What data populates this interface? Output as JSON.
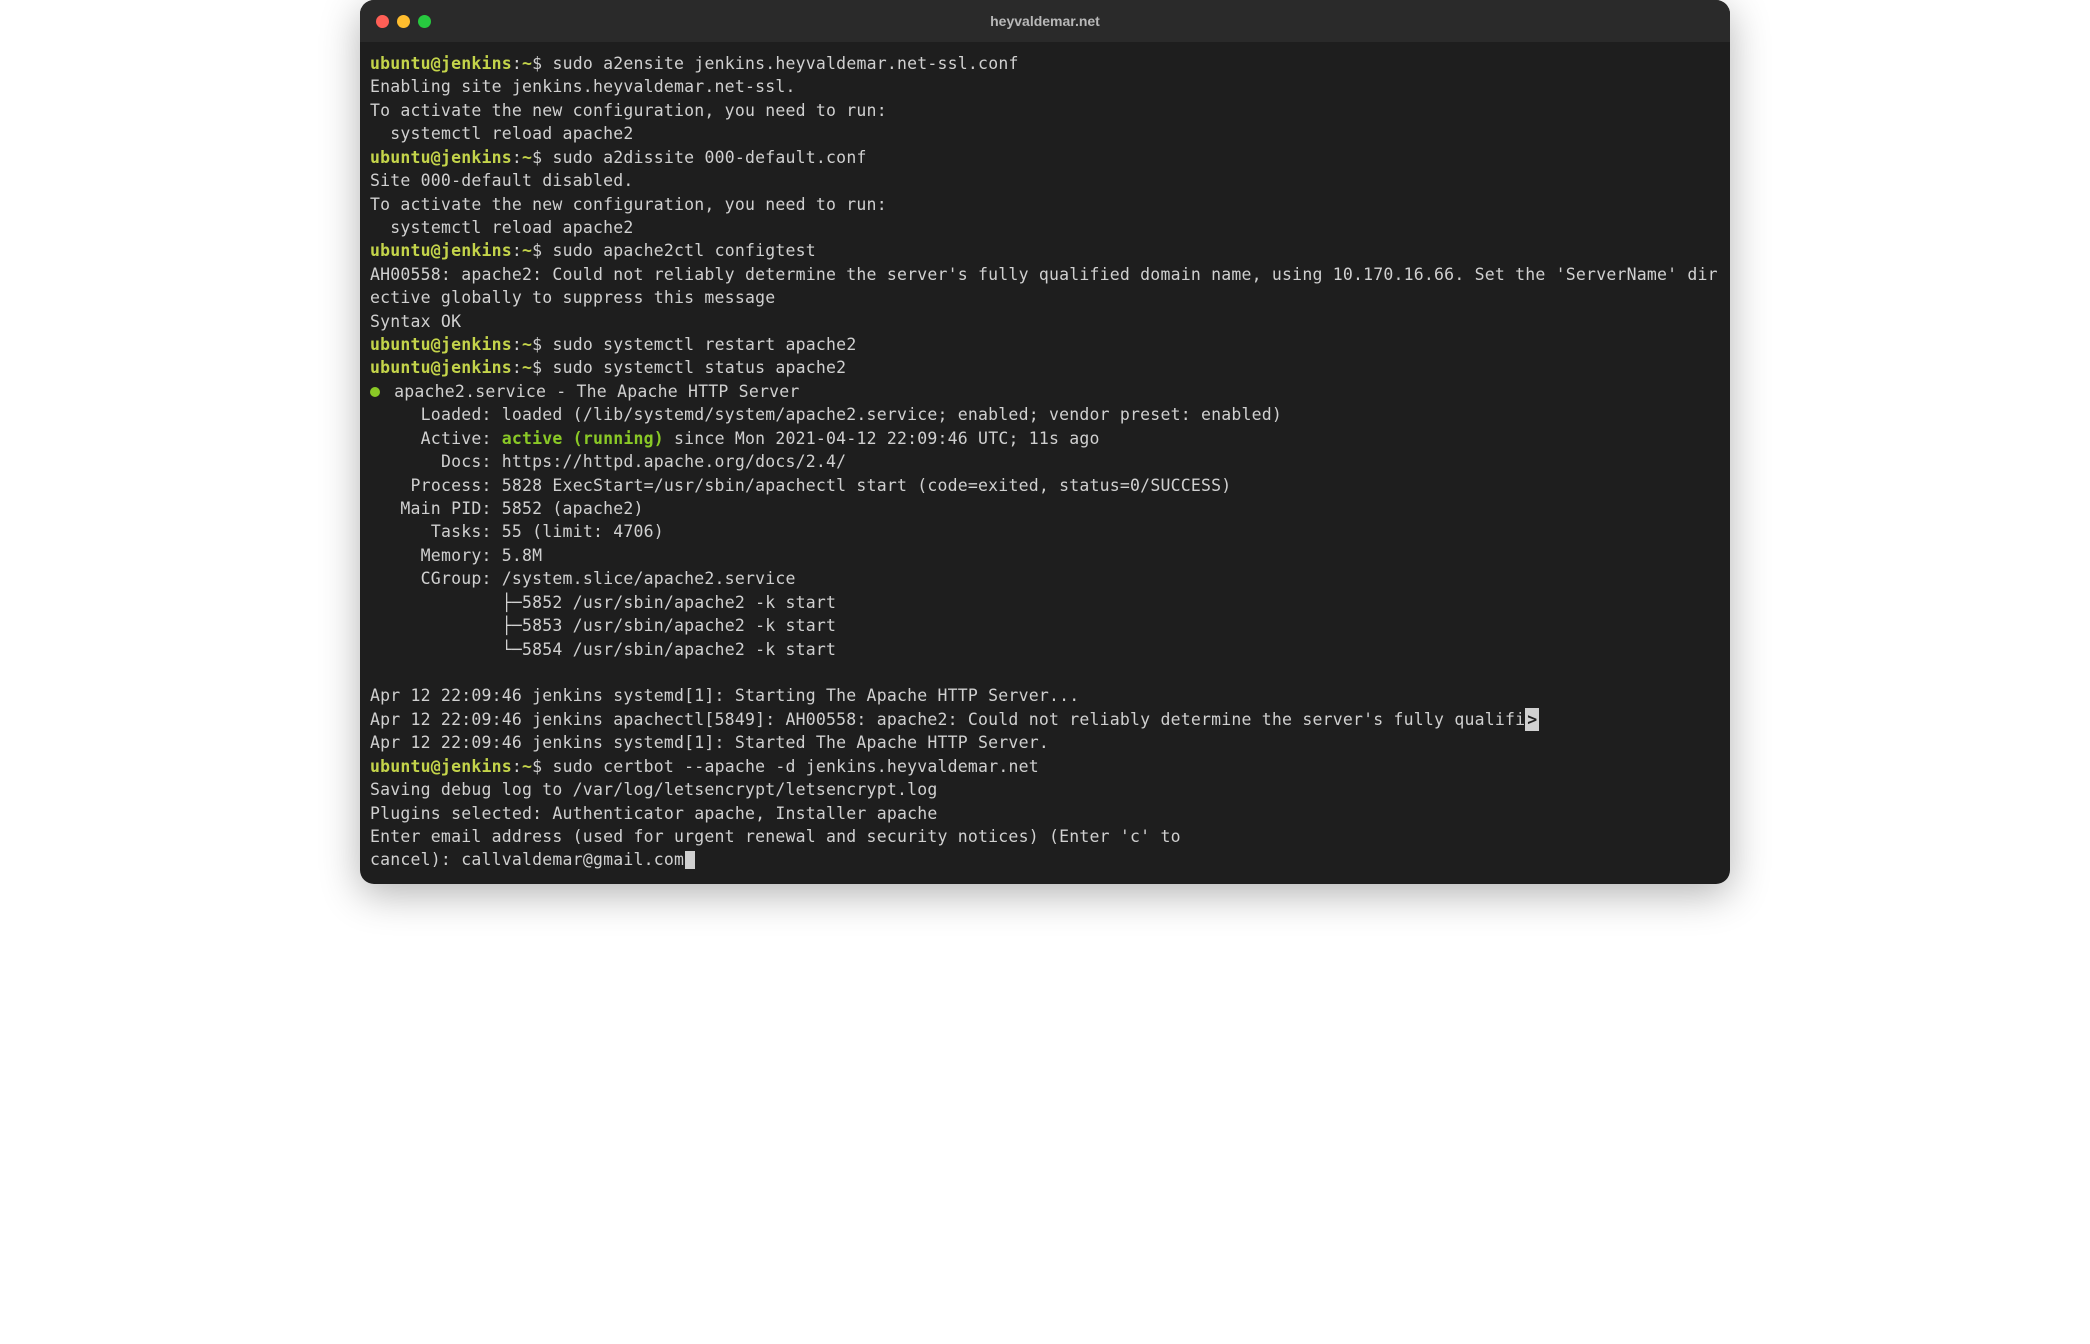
{
  "window": {
    "title": "heyvaldemar.net"
  },
  "prompt": {
    "user_host": "ubuntu@jenkins",
    "colon": ":",
    "path": "~",
    "symbol": "$"
  },
  "commands": {
    "c1": "sudo a2ensite jenkins.heyvaldemar.net-ssl.conf",
    "c2": "sudo a2dissite 000-default.conf",
    "c3": "sudo apache2ctl configtest",
    "c4": "sudo systemctl restart apache2",
    "c5": "sudo systemctl status apache2",
    "c6": "sudo certbot --apache -d jenkins.heyvaldemar.net"
  },
  "output": {
    "o1a": "Enabling site jenkins.heyvaldemar.net-ssl.",
    "o1b": "To activate the new configuration, you need to run:",
    "o1c": "  systemctl reload apache2",
    "o2a": "Site 000-default disabled.",
    "o2b": "To activate the new configuration, you need to run:",
    "o2c": "  systemctl reload apache2",
    "o3a": "AH00558: apache2: Could not reliably determine the server's fully qualified domain name, using 10.170.16.66. Set the 'ServerName' directive globally to suppress this message",
    "o3b": "Syntax OK"
  },
  "status": {
    "header": " apache2.service - The Apache HTTP Server",
    "loaded": "     Loaded: loaded (/lib/systemd/system/apache2.service; enabled; vendor preset: enabled)",
    "active_label": "     Active: ",
    "active_value": "active (running)",
    "active_since": " since Mon 2021-04-12 22:09:46 UTC; 11s ago",
    "docs": "       Docs: https://httpd.apache.org/docs/2.4/",
    "process": "    Process: 5828 ExecStart=/usr/sbin/apachectl start (code=exited, status=0/SUCCESS)",
    "mainpid": "   Main PID: 5852 (apache2)",
    "tasks": "      Tasks: 55 (limit: 4706)",
    "memory": "     Memory: 5.8M",
    "cgroup": "     CGroup: /system.slice/apache2.service",
    "cg1": "             ├─5852 /usr/sbin/apache2 -k start",
    "cg2": "             ├─5853 /usr/sbin/apache2 -k start",
    "cg3": "             └─5854 /usr/sbin/apache2 -k start"
  },
  "logs": {
    "l1": "Apr 12 22:09:46 jenkins systemd[1]: Starting The Apache HTTP Server...",
    "l2a": "Apr 12 22:09:46 jenkins apachectl[5849]: AH00558: apache2: Could not reliably determine the server's fully qualifi",
    "l2b": ">",
    "l3": "Apr 12 22:09:46 jenkins systemd[1]: Started The Apache HTTP Server."
  },
  "certbot": {
    "cb1": "Saving debug log to /var/log/letsencrypt/letsencrypt.log",
    "cb2": "Plugins selected: Authenticator apache, Installer apache",
    "cb3": "Enter email address (used for urgent renewal and security notices) (Enter 'c' to",
    "cb4a": "cancel): ",
    "cb4b": "callvaldemar@gmail.com"
  }
}
